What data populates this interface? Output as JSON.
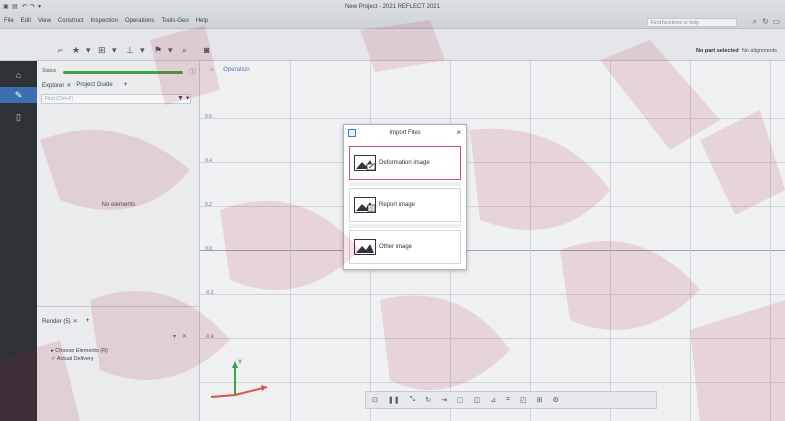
{
  "window": {
    "title": "New Project - 2021 REFLECT 2021",
    "menu": [
      "File",
      "Edit",
      "View",
      "Construct",
      "Inspection",
      "Operations",
      "Tools-Geo",
      "Help"
    ],
    "search_placeholder": "Find functions or help"
  },
  "toolbar": {
    "selection_label": "No part selected",
    "alignment_label": "No alignments"
  },
  "rail": {
    "items": [
      "lock-icon",
      "brush-icon",
      "file-icon"
    ]
  },
  "left_panel": {
    "status_label": "Status",
    "tabs": [
      "Explorer",
      "Project Guide"
    ],
    "find_placeholder": "Find (Ctrl+F)",
    "empty_message": "No elements",
    "bottom_tab": "Render (5)",
    "items": [
      "Choose Elements (R)",
      "Actual Delivery"
    ]
  },
  "view": {
    "tab_label": "Operation",
    "y_ticks": [
      "0.6",
      "0.4",
      "0.2",
      "0.0",
      "-0.2",
      "-0.4"
    ],
    "triad_label": "Y"
  },
  "dialog": {
    "title": "Import Files",
    "close_glyph": "×",
    "options": [
      {
        "label": "Deformation image"
      },
      {
        "label": "Report image"
      },
      {
        "label": "Other image"
      }
    ]
  },
  "colors": {
    "accent_orange": "#d97a2b",
    "rail_bg": "#2d3237",
    "rail_active": "#3b6fb0",
    "selected_border": "#d24b7b",
    "status_bar": "#3fa24a"
  }
}
